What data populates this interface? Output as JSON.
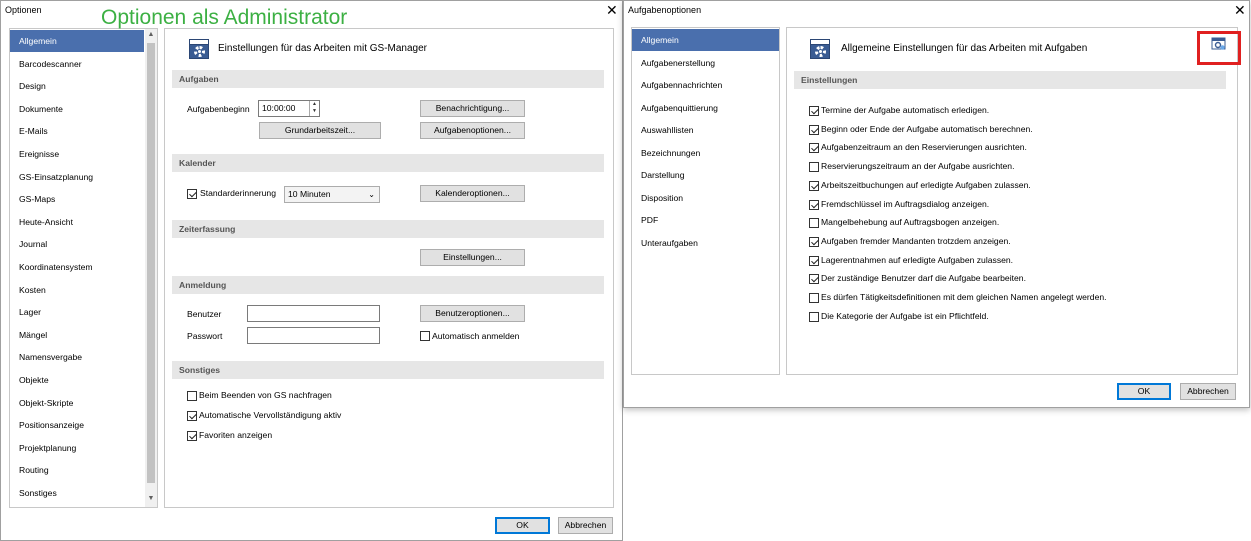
{
  "overlay_text": "Optionen als Administrator",
  "left_window": {
    "title": "Optionen",
    "close_glyph": "✕",
    "nav_items": [
      "Allgemein",
      "Barcodescanner",
      "Design",
      "Dokumente",
      "E-Mails",
      "Ereignisse",
      "GS-Einsatzplanung",
      "GS-Maps",
      "Heute-Ansicht",
      "Journal",
      "Koordinatensystem",
      "Kosten",
      "Lager",
      "Mängel",
      "Namensvergabe",
      "Objekte",
      "Objekt-Skripte",
      "Positionsanzeige",
      "Projektplanung",
      "Routing",
      "Sonstiges"
    ],
    "header": "Einstellungen für das Arbeiten mit GS-Manager",
    "sections": {
      "aufgaben": "Aufgaben",
      "kalender": "Kalender",
      "zeiterfassung": "Zeiterfassung",
      "anmeldung": "Anmeldung",
      "sonstiges": "Sonstiges"
    },
    "aufgabenbeginn_label": "Aufgabenbeginn",
    "aufgabenbeginn_value": "10:00:00",
    "btn_grundarbeitszeit": "Grundarbeitszeit...",
    "btn_benachrichtigung": "Benachrichtigung...",
    "btn_aufgabenoptionen": "Aufgabenoptionen...",
    "standarderinnerung_label": "Standarderinnerung",
    "standarderinnerung_checked": true,
    "standarderinnerung_value": "10 Minuten",
    "btn_kalenderoptionen": "Kalenderoptionen...",
    "btn_einstellungen": "Einstellungen...",
    "benutzer_label": "Benutzer",
    "benutzer_value": "",
    "passwort_label": "Passwort",
    "passwort_value": "",
    "btn_benutzeroptionen": "Benutzeroptionen...",
    "auto_anmelden_label": "Automatisch anmelden",
    "auto_anmelden_checked": false,
    "sonstiges_checks": [
      {
        "label": "Beim Beenden von GS nachfragen",
        "checked": false
      },
      {
        "label": "Automatische Vervollständigung aktiv",
        "checked": true
      },
      {
        "label": "Favoriten anzeigen",
        "checked": true
      }
    ],
    "ok": "OK",
    "cancel": "Abbrechen"
  },
  "right_window": {
    "title": "Aufgabenoptionen",
    "close_glyph": "✕",
    "nav_items": [
      "Allgemein",
      "Aufgabenerstellung",
      "Aufgabennachrichten",
      "Aufgabenquittierung",
      "Auswahllisten",
      "Bezeichnungen",
      "Darstellung",
      "Disposition",
      "PDF",
      "Unteraufgaben"
    ],
    "header": "Allgemeine Einstellungen für das Arbeiten mit Aufgaben",
    "section": "Einstellungen",
    "checks": [
      {
        "label": "Termine der Aufgabe automatisch erledigen.",
        "checked": true
      },
      {
        "label": "Beginn oder Ende der Aufgabe automatisch berechnen.",
        "checked": true
      },
      {
        "label": "Aufgabenzeitraum an den Reservierungen ausrichten.",
        "checked": true
      },
      {
        "label": "Reservierungszeitraum an der Aufgabe ausrichten.",
        "checked": false
      },
      {
        "label": "Arbeitszeitbuchungen auf erledigte Aufgaben zulassen.",
        "checked": true
      },
      {
        "label": "Fremdschlüssel im Auftragsdialog anzeigen.",
        "checked": true
      },
      {
        "label": "Mangelbehebung auf Auftragsbogen anzeigen.",
        "checked": false
      },
      {
        "label": "Aufgaben fremder Mandanten trotzdem anzeigen.",
        "checked": true
      },
      {
        "label": "Lagerentnahmen auf erledigte Aufgaben zulassen.",
        "checked": true
      },
      {
        "label": "Der zuständige Benutzer darf die Aufgabe bearbeiten.",
        "checked": true
      },
      {
        "label": "Es dürfen Tätigkeitsdefinitionen mit dem gleichen Namen angelegt werden.",
        "checked": false
      },
      {
        "label": "Die Kategorie der Aufgabe ist ein Pflichtfeld.",
        "checked": false
      }
    ],
    "ok": "OK",
    "cancel": "Abbrechen"
  },
  "colors": {
    "selection": "#4a6fad",
    "overlay": "#3cb043",
    "highlight": "#e02020"
  }
}
